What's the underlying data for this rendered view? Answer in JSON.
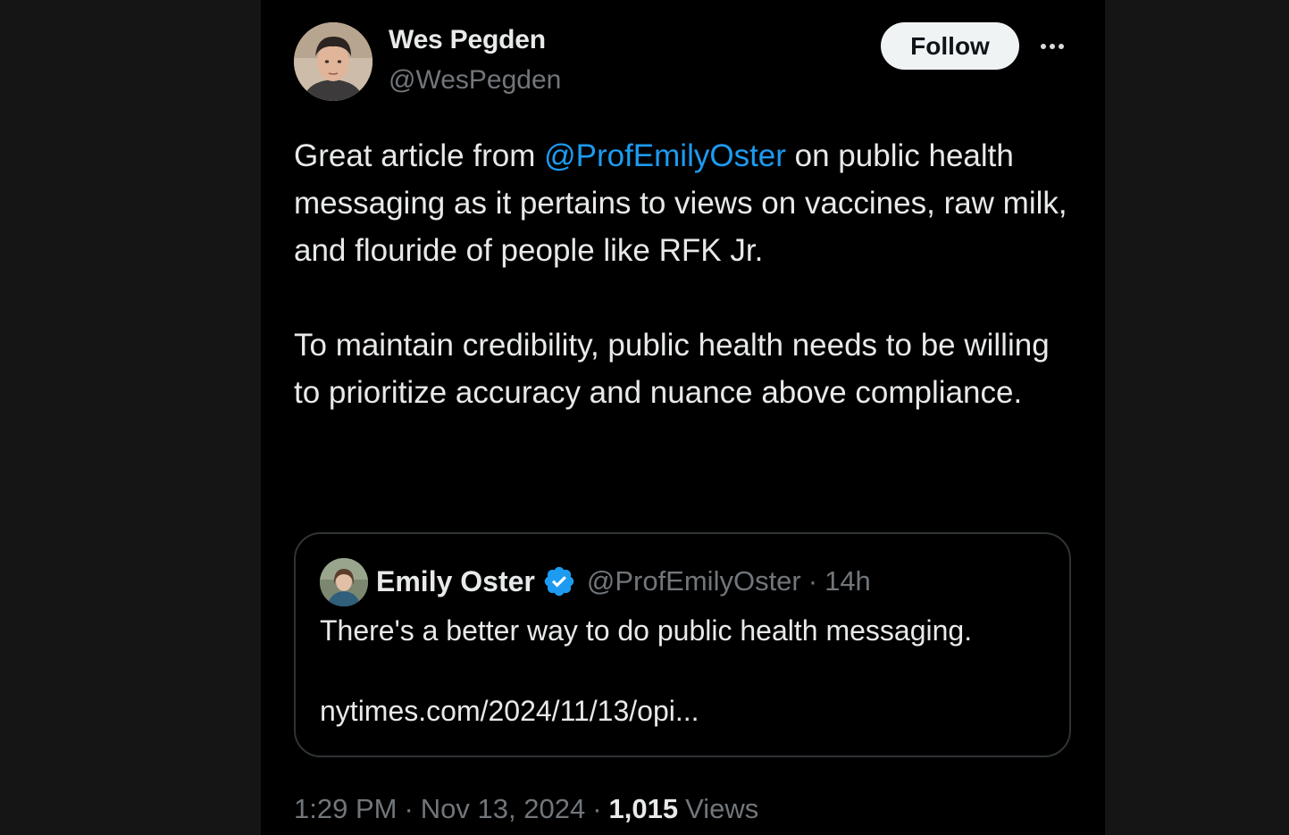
{
  "author": {
    "name": "Wes Pegden",
    "handle": "@WesPegden"
  },
  "actions": {
    "follow_label": "Follow"
  },
  "tweet": {
    "line1_prefix": "Great article from ",
    "mention": "@ProfEmilyOster",
    "line1_suffix": " on public health messaging as it pertains to views on vaccines, raw milk, and flouride of people like RFK Jr.",
    "paragraph2": "To maintain credibility, public health needs to be willing to prioritize accuracy and nuance above compliance."
  },
  "quoted": {
    "name": "Emily Oster",
    "handle": "@ProfEmilyOster",
    "separator": "·",
    "time": "14h",
    "text": "There's a better way to do public health messaging.",
    "link": "nytimes.com/2024/11/13/opi..."
  },
  "meta": {
    "time": "1:29 PM",
    "separator": "·",
    "date": "Nov 13, 2024",
    "views_count": "1,015",
    "views_label": "Views"
  },
  "colors": {
    "background": "#000000",
    "link": "#1d9bf0",
    "secondary_text": "#71767b",
    "verified_badge": "#1d9bf0"
  }
}
